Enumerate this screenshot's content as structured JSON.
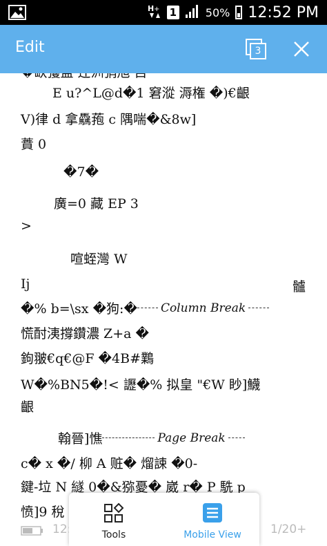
{
  "status_bar": {
    "sim_number": "1",
    "battery_percent": "50%",
    "time": "12:52 PM"
  },
  "app_bar": {
    "title": "Edit",
    "page_count": "3"
  },
  "document": {
    "lines": [
      "�缺彏盅·迕汌弰旭·目",
      "E u?^L@d�1 窘漎 溽権 �)€齦",
      "V)律 d 拿驫菢 c 隅喘�&8w]",
      "蕡 0",
      "�7�",
      "廣=0 藏 EP 3",
      ">",
      "喧蛭灣 W",
      "Ij",
      "髗",
      "�%  b=\\sx  �狗:�",
      "慌酎洟撐鑽濃 Z+a �",
      "鉤翍€q€@F   �4B#鸈",
      "W�%BN5�!< 讈�% 拟皇 \"€W  眇]鱴",
      "齦",
      "翰晉]憔",
      "c�  x   �/  柳 A 赃� 熘誎  �0-",
      "鍵-垃 N 繸 0�&猕憂� 崴 r�  P 駪 p",
      "愤]9 稅"
    ],
    "column_break_label": "Column Break",
    "page_break_label": "Page Break"
  },
  "bottom_bar": {
    "tools_label": "Tools",
    "mobile_view_label": "Mobile View",
    "time_partial": "12:",
    "page_indicator": "1/20+"
  },
  "colors": {
    "accent": "#5fb0ec",
    "mobile_view_active": "#3aa0ea"
  }
}
